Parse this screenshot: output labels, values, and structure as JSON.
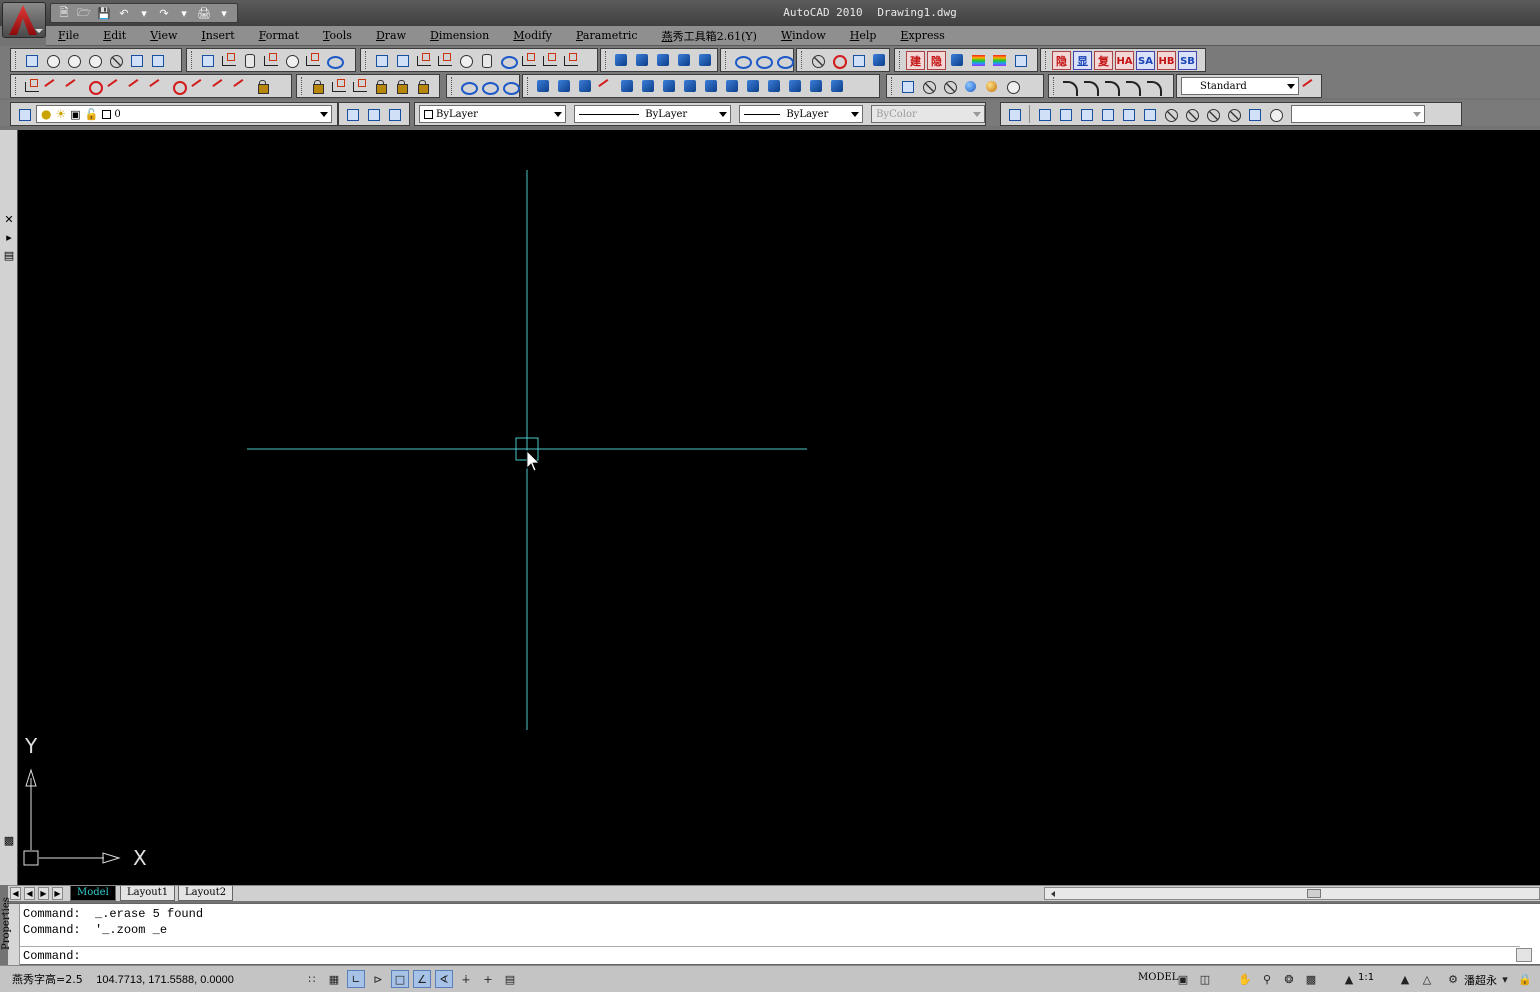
{
  "window": {
    "title_app": "AutoCAD 2010",
    "title_doc": "Drawing1.dwg"
  },
  "quick_access": [
    "new-icon",
    "open-icon",
    "save-icon",
    "undo-icon",
    "redo-icon",
    "plot-icon"
  ],
  "menu": [
    "File",
    "Edit",
    "View",
    "Insert",
    "Format",
    "Tools",
    "Draw",
    "Dimension",
    "Modify",
    "Parametric",
    "燕秀工具箱2.61(Y)",
    "Window",
    "Help",
    "Express"
  ],
  "toolbar3": {
    "layer_name": "0",
    "color": "ByLayer",
    "linetype": "ByLayer",
    "lineweight": "ByLayer",
    "plotstyle": "ByColor",
    "textstyle": "Standard",
    "view": ""
  },
  "toolbar_tags": [
    "建",
    "隐",
    "HA",
    "SA",
    "HB",
    "SB"
  ],
  "left_strip": {
    "properties_label": "Properties"
  },
  "ucs": {
    "x_label": "X",
    "y_label": "Y"
  },
  "tabs": [
    "Model",
    "Layout1",
    "Layout2"
  ],
  "command_history": [
    "Command:  _.erase 5 found",
    "Command:  '_.zoom _e"
  ],
  "command_prompt": "Command:",
  "status": {
    "text_height": "燕秀字高=2.5",
    "coords": "104.7713,  171.5588,  0.0000",
    "model": "MODEL",
    "scale": "1:1",
    "user": "潘超永"
  },
  "colors": {
    "crosshair": "#4ac8c8",
    "background": "#000000",
    "ucs": "#e0e0e0",
    "active_tab_text": "#33cccc"
  }
}
